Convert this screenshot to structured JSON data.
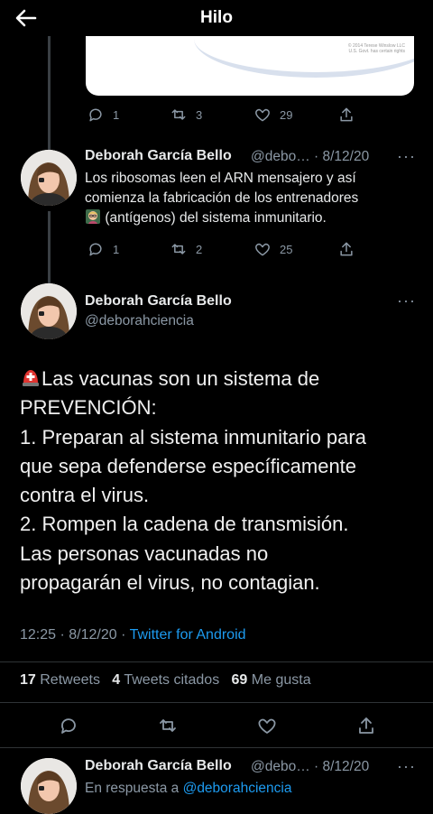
{
  "header": {
    "title": "Hilo"
  },
  "media": {
    "credit_line1": "© 2014 Terese Winslow LLC",
    "credit_line2": "U.S. Govt. has certain rights"
  },
  "tweet1": {
    "reply_count": "1",
    "retweet_count": "3",
    "like_count": "29"
  },
  "tweet2": {
    "author_name": "Deborah García Bello",
    "handle_time": "@debo… · 8/12/20",
    "text_line1": "Los ribosomas leen el ARN mensajero y así",
    "text_line2": "comienza la fabricación de los entrenadores",
    "text_line3": "(antígenos) del sistema inmunitario.",
    "reply_count": "1",
    "retweet_count": "2",
    "like_count": "25"
  },
  "main_tweet": {
    "author_name": "Deborah García Bello",
    "handle": "@deborahciencia",
    "lines": [
      "Las vacunas son un sistema de",
      "PREVENCIÓN:",
      "1. Preparan al sistema inmunitario para",
      "que sepa defenderse específicamente",
      "contra el virus.",
      "2. Rompen la cadena de transmisión.",
      "Las personas vacunadas no",
      "propagarán el virus, no contagian."
    ],
    "time_date": "12:25 · 8/12/20 ·",
    "client": "Twitter for Android",
    "retweets_num": "17",
    "retweets_label": "Retweets",
    "quotes_num": "4",
    "quotes_label": "Tweets citados",
    "likes_num": "69",
    "likes_label": "Me gusta"
  },
  "reply_tweet": {
    "author_name": "Deborah García Bello",
    "handle_time": "@debo… · 8/12/20",
    "reply_prefix": "En respuesta a",
    "reply_to": "@deborahciencia"
  },
  "colors": {
    "background": "#000000",
    "link": "#1d9bf0",
    "muted": "#8b98a5",
    "divider": "#2f3336"
  }
}
